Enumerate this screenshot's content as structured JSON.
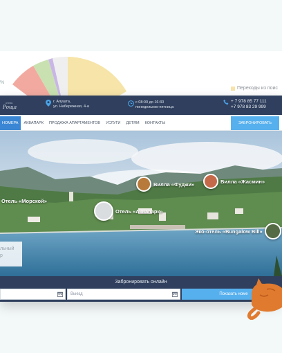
{
  "background": {
    "percent_fragment": "%",
    "legend_label": "Переходы из поис",
    "legend_color": "#f6e4a8",
    "pie_colors": [
      "#f6e4a8",
      "#f2aaa0",
      "#c9e1b1",
      "#c9b6e6",
      "#f0f0f0"
    ]
  },
  "header": {
    "logo_text": "Роща",
    "logo_sub": "отель",
    "address": [
      "г. Алушта,",
      "ул. Набережная, 4-а"
    ],
    "hours": [
      "с 08:00 до 16:30",
      "понедельник-пятница"
    ],
    "phones": [
      "+ 7 978 85 77 111",
      "+7 978 83 29 999"
    ],
    "icons": {
      "address": "location-pin-icon",
      "hours": "clock-icon",
      "phone": "phone-icon"
    }
  },
  "nav": {
    "items": [
      "НОМЕРА",
      "АКВАПАРК",
      "ПРОДАЖА АПАРТАМЕНТОВ",
      "УСЛУГИ",
      "ДЕТЯМ",
      "КОНТАКТЫ"
    ],
    "active_index": 0,
    "book_button": "ЗАБРОНИРОВАТЬ"
  },
  "hero": {
    "pins": [
      "Отель «Морской»",
      "Вилла «Фуджи»",
      "Вилла «Жасмин»",
      "Отель «Аквапарк»",
      "Эко-отель «Bungalow Bill»"
    ],
    "side_card": [
      "льный",
      "р"
    ]
  },
  "booking": {
    "title": "Забронировать онлайн",
    "checkin_placeholder": "",
    "checkout_placeholder": "Выезд",
    "show_button": "Показать номе",
    "accent_color": "#57b0ee"
  },
  "colors": {
    "header_bg": "#2f3f5d",
    "nav_active": "#3a86d4",
    "page_bg": "#f3f8f8"
  }
}
